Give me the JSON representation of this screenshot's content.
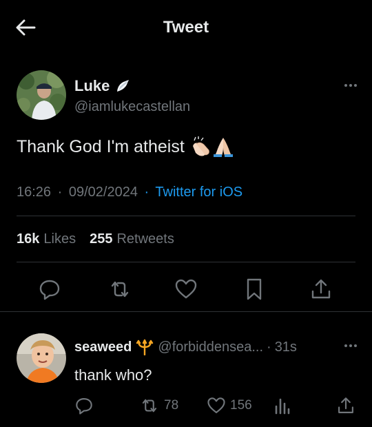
{
  "header": {
    "title": "Tweet",
    "back_icon": "arrow-left-icon"
  },
  "tweet": {
    "author": {
      "name": "Luke",
      "badge_icon": "angel-wing-emoji",
      "handle": "@iamlukecastellan"
    },
    "text": "Thank God I'm atheist",
    "emoji_icons": [
      "clapping-hands-emoji",
      "folded-hands-emoji"
    ],
    "time": "16:26",
    "date": "09/02/2024",
    "separator": "·",
    "source": "Twitter for iOS",
    "stats": {
      "likes_count": "16k",
      "likes_label": "Likes",
      "retweets_count": "255",
      "retweets_label": "Retweets"
    },
    "actions": [
      "reply-icon",
      "retweet-icon",
      "like-icon",
      "bookmark-icon",
      "share-icon"
    ]
  },
  "reply": {
    "name": "seaweed",
    "badge_icon": "trident-emoji",
    "handle": "@forbiddensea...",
    "separator": "·",
    "time": "31s",
    "text": "thank who?",
    "retweets": "78",
    "likes": "156"
  },
  "colors": {
    "background": "#000000",
    "text": "#e7e9ea",
    "secondary": "#71767b",
    "link": "#1d9bf0",
    "divider": "#2f3336"
  }
}
